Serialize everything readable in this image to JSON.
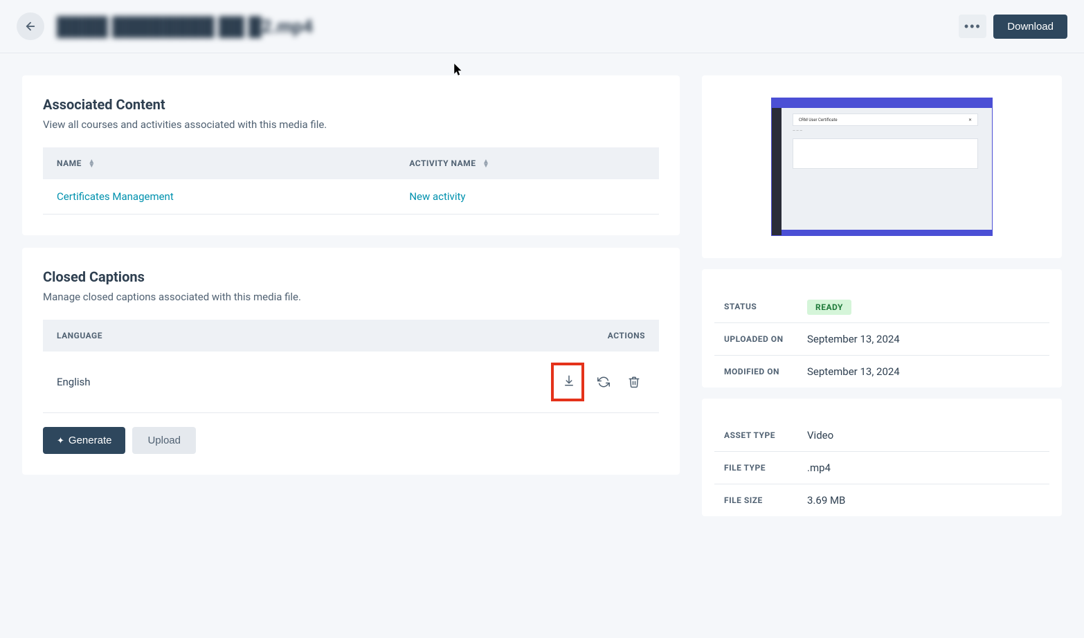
{
  "header": {
    "title": "████ ████████ ██ █2.mp4",
    "download_label": "Download"
  },
  "associated": {
    "title": "Associated Content",
    "subtitle": "View all courses and activities associated with this media file.",
    "col_name": "NAME",
    "col_activity": "ACTIVITY NAME",
    "rows": [
      {
        "name": "Certificates Management",
        "activity": "New activity"
      }
    ]
  },
  "captions": {
    "title": "Closed Captions",
    "subtitle": "Manage closed captions associated with this media file.",
    "col_language": "LANGUAGE",
    "col_actions": "ACTIONS",
    "rows": [
      {
        "language": "English"
      }
    ],
    "generate_label": "Generate",
    "upload_label": "Upload"
  },
  "thumb": {
    "label": "CRM User Certificate"
  },
  "metadata_dates": {
    "status_label": "STATUS",
    "status_value": "READY",
    "uploaded_label": "UPLOADED ON",
    "uploaded_value": "September 13, 2024",
    "modified_label": "MODIFIED ON",
    "modified_value": "September 13, 2024"
  },
  "metadata_file": {
    "asset_type_label": "ASSET TYPE",
    "asset_type_value": "Video",
    "file_type_label": "FILE TYPE",
    "file_type_value": ".mp4",
    "file_size_label": "FILE SIZE",
    "file_size_value": "3.69 MB"
  }
}
